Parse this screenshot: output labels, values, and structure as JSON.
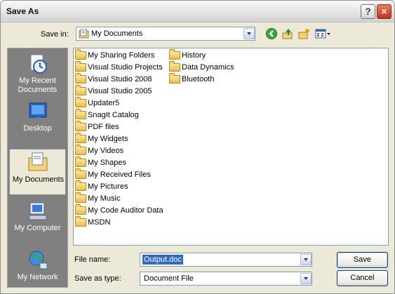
{
  "window": {
    "title": "Save As",
    "help_glyph": "?",
    "close_glyph": "×"
  },
  "lookin": {
    "label": "Save in:",
    "value": "My Documents"
  },
  "toolbar": {
    "icons": [
      "back-icon",
      "up-folder-icon",
      "new-folder-icon",
      "views-menu-icon"
    ]
  },
  "places": [
    {
      "label": "My Recent Documents",
      "icon": "recent-documents-icon"
    },
    {
      "label": "Desktop",
      "icon": "desktop-icon"
    },
    {
      "label": "My Documents",
      "icon": "my-documents-icon",
      "selected": true
    },
    {
      "label": "My Computer",
      "icon": "my-computer-icon"
    },
    {
      "label": "My Network",
      "icon": "my-network-icon"
    }
  ],
  "files": {
    "column1": [
      "My Sharing Folders",
      "Visual Studio Projects",
      "Visual Studio 2008",
      "Visual Studio 2005",
      "Updater5",
      "SnagIt Catalog",
      "PDF files",
      "My Widgets",
      "My Videos",
      "My Shapes",
      "My Received Files",
      "My Pictures",
      "My Music",
      "My Code Auditor Data",
      "MSDN"
    ],
    "column2": [
      "History",
      "Data Dynamics",
      "Bluetooth"
    ]
  },
  "filename": {
    "label": "File name:",
    "value": "Output.doc"
  },
  "savetype": {
    "label": "Save as type:",
    "value": "Document File"
  },
  "buttons": {
    "save": "Save",
    "cancel": "Cancel"
  },
  "colors": {
    "places_bar": "#808080",
    "dialog": "#ece9d8",
    "selection": "#316ac5",
    "close": "#c2351c"
  }
}
